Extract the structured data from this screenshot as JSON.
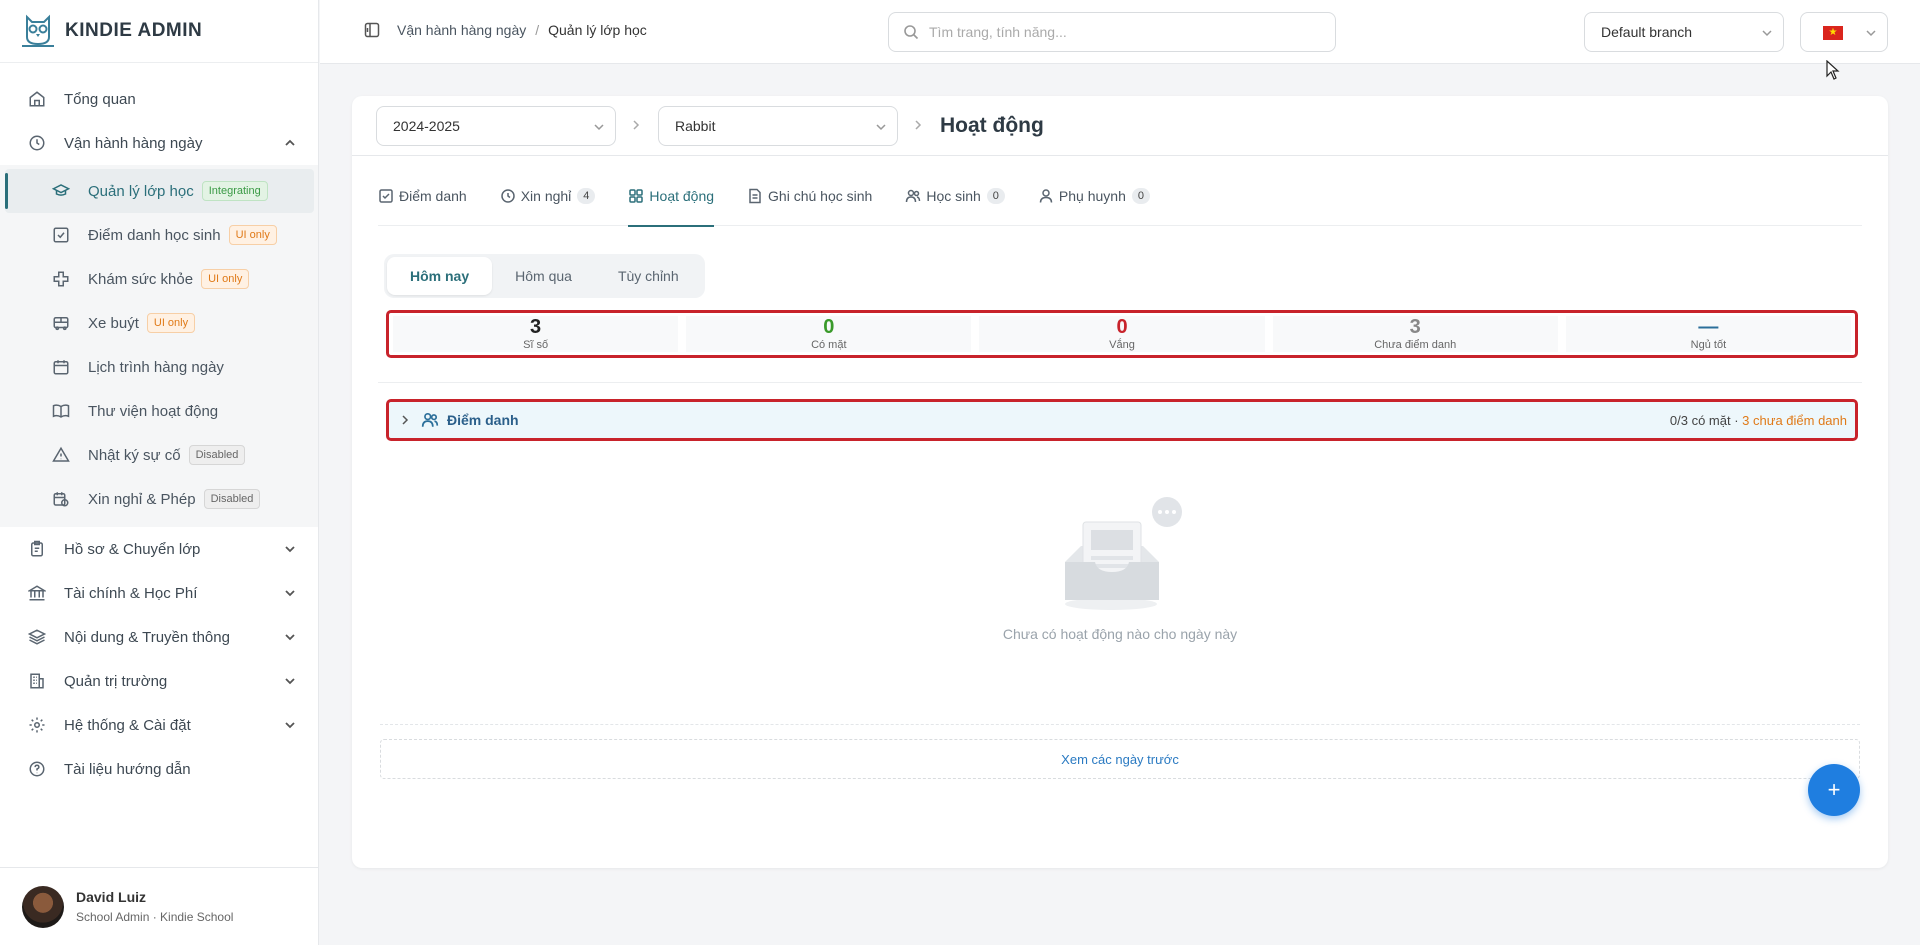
{
  "app": {
    "brand": "KINDIE ADMIN"
  },
  "sidebar": {
    "items": [
      {
        "label": "Tổng quan",
        "icon": "home-icon"
      },
      {
        "label": "Vận hành hàng ngày",
        "icon": "clock-icon",
        "expanded": true
      },
      {
        "label": "Hồ sơ & Chuyển lớp",
        "icon": "clipboard-icon"
      },
      {
        "label": "Tài chính & Học Phí",
        "icon": "bank-icon"
      },
      {
        "label": "Nội dung & Truyền thông",
        "icon": "layers-icon"
      },
      {
        "label": "Quản trị trường",
        "icon": "building-icon"
      },
      {
        "label": "Hệ thống & Cài đặt",
        "icon": "gear-icon"
      },
      {
        "label": "Tài liệu hướng dẫn",
        "icon": "help-icon"
      }
    ],
    "subitems": [
      {
        "label": "Quản lý lớp học",
        "badge": "Integrating",
        "active": true
      },
      {
        "label": "Điểm danh học sinh",
        "badge": "UI only"
      },
      {
        "label": "Khám sức khỏe",
        "badge": "UI only"
      },
      {
        "label": "Xe buýt",
        "badge": "UI only"
      },
      {
        "label": "Lịch trình hàng ngày"
      },
      {
        "label": "Thư viện hoạt động"
      },
      {
        "label": "Nhật ký sự cố",
        "badge": "Disabled"
      },
      {
        "label": "Xin nghỉ & Phép",
        "badge": "Disabled"
      }
    ]
  },
  "user": {
    "name": "David Luiz",
    "role": "School Admin · Kindie School"
  },
  "topbar": {
    "breadcrumb": [
      "Vận hành hàng ngày",
      "Quản lý lớp học"
    ],
    "search_placeholder": "Tìm trang, tính năng...",
    "branch": "Default branch",
    "language": "vi"
  },
  "main": {
    "year": "2024-2025",
    "class": "Rabbit",
    "title": "Hoạt động",
    "tabs": [
      {
        "label": "Điểm danh"
      },
      {
        "label": "Xin nghỉ",
        "count": "4"
      },
      {
        "label": "Hoạt động",
        "active": true
      },
      {
        "label": "Ghi chú học sinh"
      },
      {
        "label": "Học sinh",
        "count": "0"
      },
      {
        "label": "Phụ huynh",
        "count": "0"
      }
    ],
    "date_filter": [
      "Hôm nay",
      "Hôm qua",
      "Tùy chỉnh"
    ],
    "stats": [
      {
        "value": "3",
        "label": "Sĩ số",
        "color": "#222222"
      },
      {
        "value": "0",
        "label": "Có mặt",
        "color": "#3a9a2a"
      },
      {
        "value": "0",
        "label": "Vắng",
        "color": "#c8232b"
      },
      {
        "value": "3",
        "label": "Chưa điểm danh",
        "color": "#888888"
      },
      {
        "value": "—",
        "label": "Ngủ tốt",
        "color": "#2b6f9a"
      }
    ],
    "attendance": {
      "title": "Điểm danh",
      "present": "0/3 có mặt",
      "separator": " · ",
      "pending": "3 chưa điểm danh"
    },
    "empty_text": "Chưa có hoạt động nào cho ngày này",
    "more_label": "Xem các ngày trước",
    "fab_label": "+"
  }
}
